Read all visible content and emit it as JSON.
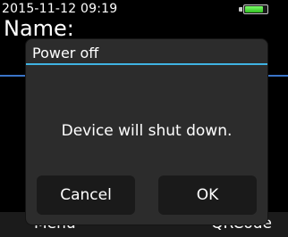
{
  "status": {
    "timestamp": "2015-11-12 09:19",
    "battery_icon": "battery-icon",
    "battery_level": 0.85,
    "battery_color": "#4fdc3a"
  },
  "background": {
    "name_label": "Name:",
    "softkeys": {
      "left": "Menu",
      "right": "QRCode"
    },
    "accent_rule_color": "#3a74c8"
  },
  "dialog": {
    "title": "Power off",
    "message": "Device will shut down.",
    "cancel_label": "Cancel",
    "ok_label": "OK",
    "accent_color": "#3fb3e3"
  }
}
